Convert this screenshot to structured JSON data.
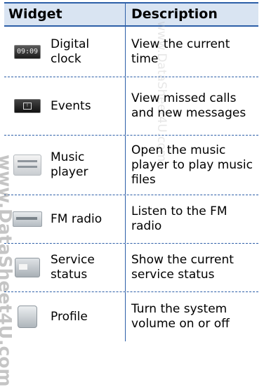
{
  "table": {
    "headers": {
      "widget": "Widget",
      "description": "Description"
    },
    "rows": [
      {
        "icon": "digital-clock-icon",
        "icon_text": "09:09",
        "name": "Digital clock",
        "description": "View the current time"
      },
      {
        "icon": "events-icon",
        "icon_text": "!",
        "name": "Events",
        "description": "View missed calls and new messages"
      },
      {
        "icon": "music-player-icon",
        "name": "Music player",
        "description": "Open the music player to play music files"
      },
      {
        "icon": "fm-radio-icon",
        "name": "FM radio",
        "description": "Listen to the FM radio"
      },
      {
        "icon": "service-status-icon",
        "name": "Service status",
        "description": "Show the current service status"
      },
      {
        "icon": "profile-icon",
        "name": "Profile",
        "description": "Turn the system volume on or off"
      }
    ]
  },
  "watermark": {
    "vertical_text": "www.DataSheet4U.com",
    "faint_text": "www.DataSheet4U.com"
  },
  "colors": {
    "rule": "#2d5fa8",
    "header_background": "#d9e4f2"
  }
}
